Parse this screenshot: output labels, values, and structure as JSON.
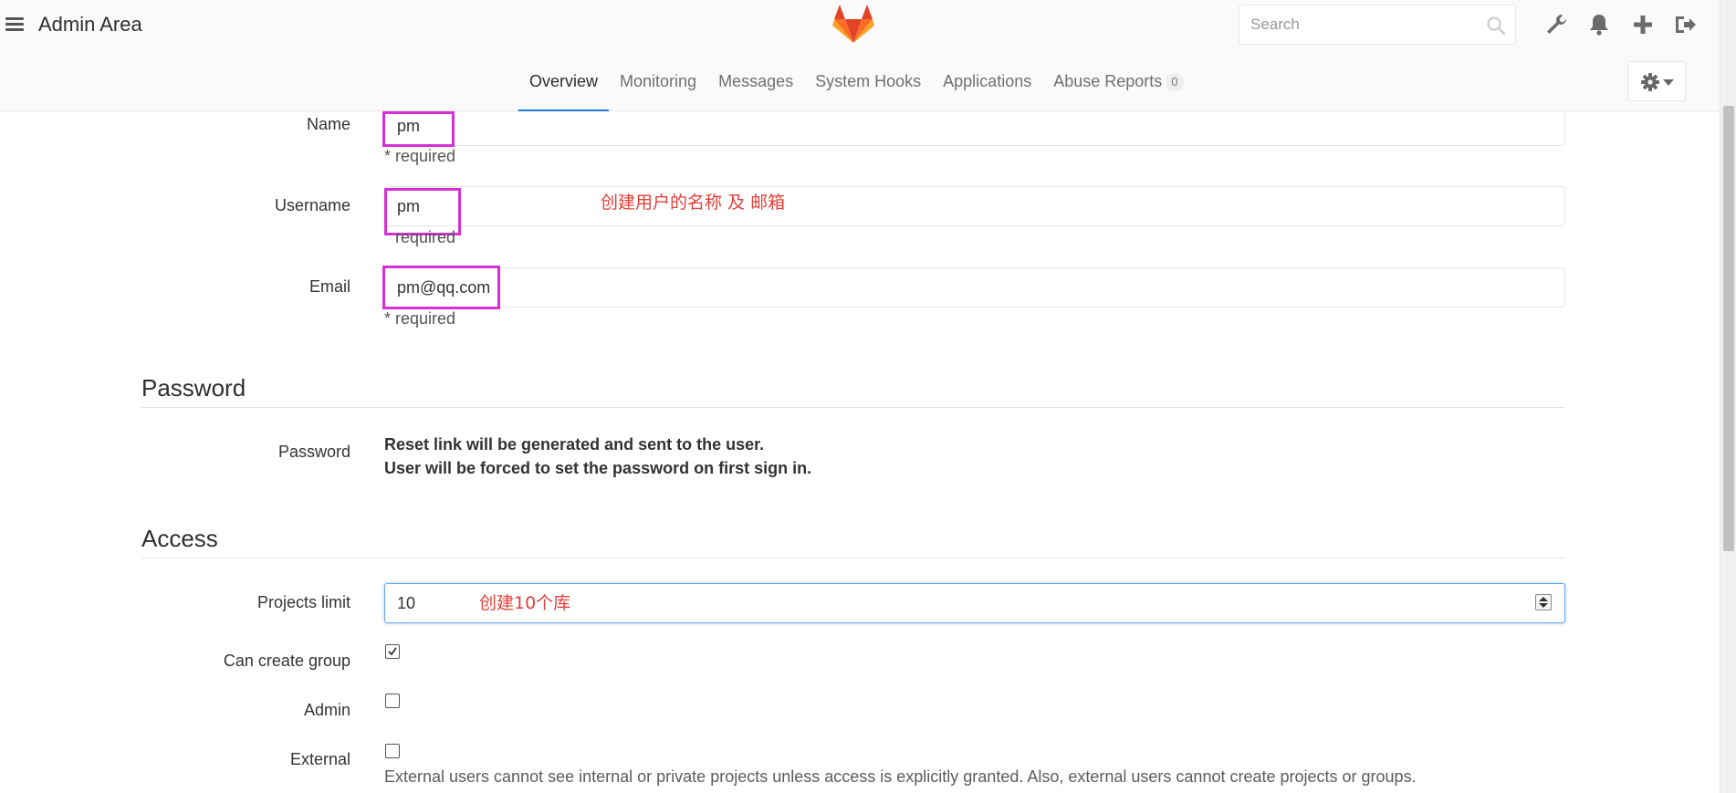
{
  "header": {
    "title": "Admin Area",
    "search_placeholder": "Search",
    "icons": [
      "menu-icon",
      "gitlab-logo",
      "search-icon",
      "wrench-icon",
      "bell-icon",
      "plus-icon",
      "sign-out-icon",
      "gear-icon",
      "caret-down-icon"
    ]
  },
  "nav": {
    "tabs": [
      {
        "label": "Overview",
        "active": true
      },
      {
        "label": "Monitoring"
      },
      {
        "label": "Messages"
      },
      {
        "label": "System Hooks"
      },
      {
        "label": "Applications"
      },
      {
        "label": "Abuse Reports",
        "badge": "0"
      }
    ]
  },
  "form": {
    "name": {
      "label": "Name",
      "value": "pm",
      "hint": "* required"
    },
    "username": {
      "label": "Username",
      "value": "pm",
      "hint": "required"
    },
    "email": {
      "label": "Email",
      "value": "pm@qq.com",
      "hint": "* required"
    },
    "password_section": {
      "title": "Password",
      "label": "Password",
      "line1": "Reset link will be generated and sent to the user.",
      "line2": "User will be forced to set the password on first sign in."
    },
    "access_section": {
      "title": "Access",
      "projects_limit": {
        "label": "Projects limit",
        "value": "10"
      },
      "can_create_group": {
        "label": "Can create group",
        "checked": true
      },
      "admin": {
        "label": "Admin",
        "checked": false
      },
      "external": {
        "label": "External",
        "checked": false,
        "help": "External users cannot see internal or private projects unless access is explicitly granted. Also, external users cannot create projects or groups."
      }
    }
  },
  "annotations": {
    "user_note": "创建用户的名称 及 邮箱",
    "limit_note": "创建10个库",
    "color": "#e0403a",
    "box_color": "#d62fd6"
  },
  "colors": {
    "accent": "#1f78d1",
    "header_bg": "#fafafa"
  }
}
